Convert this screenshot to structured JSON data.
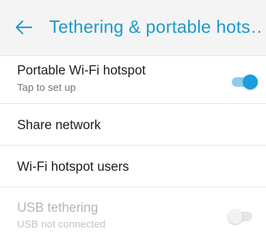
{
  "app_bar": {
    "title": "Tethering & portable hots…",
    "back_icon": "arrow-back-icon",
    "accent_color": "#1c9bc8"
  },
  "items": [
    {
      "label": "Portable Wi-Fi hotspot",
      "subtitle": "Tap to set up",
      "toggle": "on"
    },
    {
      "label": "Share network"
    },
    {
      "label": "Wi-Fi hotspot users"
    },
    {
      "label": "USB tethering",
      "subtitle": "USB not connected",
      "toggle": "off",
      "enabled": false
    }
  ],
  "colors": {
    "toggle_on": "#1a9ee0",
    "divider": "#e4e4e4"
  }
}
